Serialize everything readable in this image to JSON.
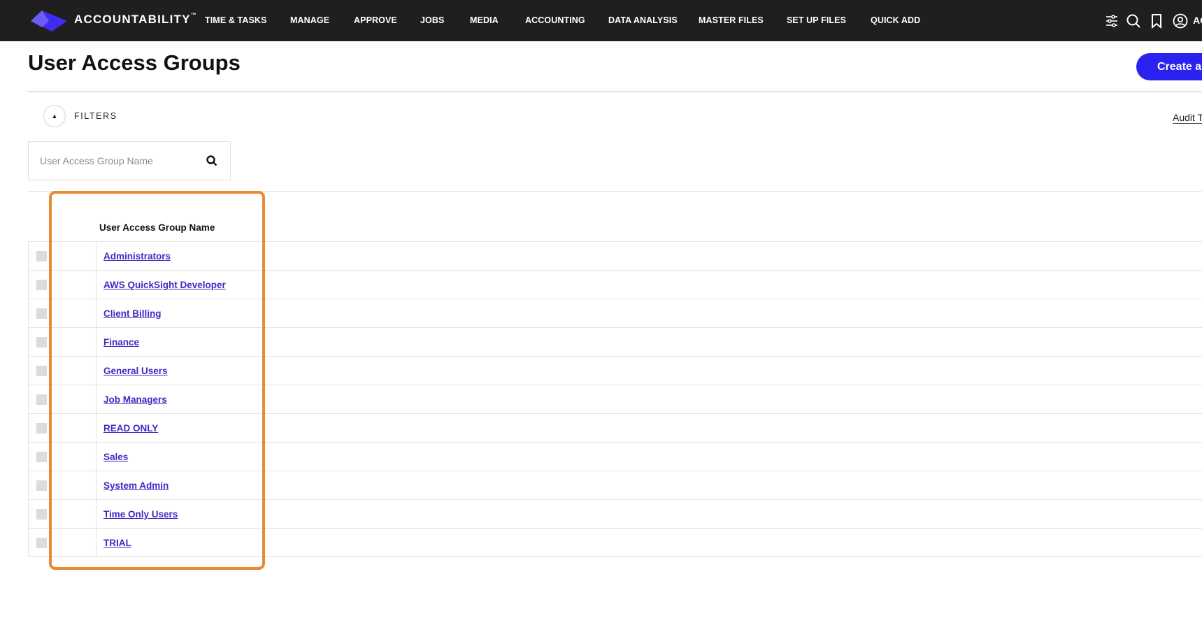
{
  "app": {
    "brand": "ACCOUNTABILITY",
    "brand_mark": "™",
    "nav": [
      "TIME & TASKS",
      "MANAGE",
      "APPROVE",
      "JOBS",
      "MEDIA",
      "ACCOUNTING",
      "DATA ANALYSIS",
      "MASTER FILES",
      "SET UP FILES",
      "QUICK ADD"
    ],
    "top_icons": [
      "sliders-icon",
      "search-icon",
      "bookmark-icon",
      "user-icon"
    ],
    "account_cut_label": "AC"
  },
  "page": {
    "title": "User Access Groups",
    "create_button": "Create a"
  },
  "filters": {
    "label": "FILTERS",
    "audit_link": "Audit T",
    "search_placeholder": "User Access Group Name"
  },
  "table": {
    "column_header": "User Access Group Name",
    "rows": [
      "Administrators",
      "AWS QuickSight Developer",
      "Client Billing",
      "Finance",
      "General Users",
      "Job Managers",
      "READ ONLY",
      "Sales",
      "System Admin",
      "Time Only Users",
      "TRIAL"
    ]
  },
  "colors": {
    "topbar": "#1f1f1f",
    "accent": "#2b22f0",
    "link": "#3b2bc4",
    "highlight": "#e88a33"
  }
}
